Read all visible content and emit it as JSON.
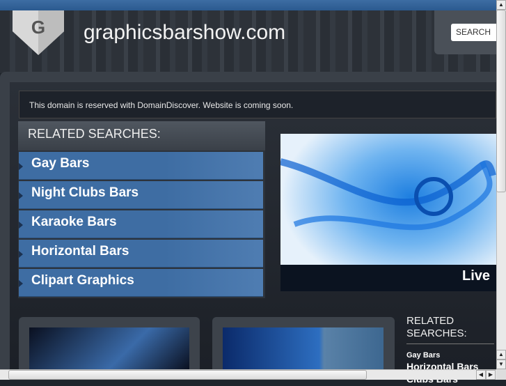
{
  "header": {
    "site_title": "graphicsbarshow.com",
    "logo_letter": "G",
    "search_label": "SEARCH"
  },
  "notice": "This domain is reserved with DomainDiscover. Website is coming soon.",
  "related": {
    "title": "RELATED SEARCHES:",
    "items": [
      {
        "label": "Gay Bars"
      },
      {
        "label": "Night Clubs Bars"
      },
      {
        "label": "Karaoke Bars"
      },
      {
        "label": "Horizontal Bars"
      },
      {
        "label": "Clipart Graphics"
      }
    ]
  },
  "hero": {
    "caption": "Live"
  },
  "related2": {
    "title": "RELATED SEARCHES:",
    "items": [
      "Gay Bars",
      "Horizontal Bars",
      "Clubs Bars"
    ]
  },
  "colors": {
    "accent": "#3e6da3",
    "topbar": "#2b5a8f"
  }
}
